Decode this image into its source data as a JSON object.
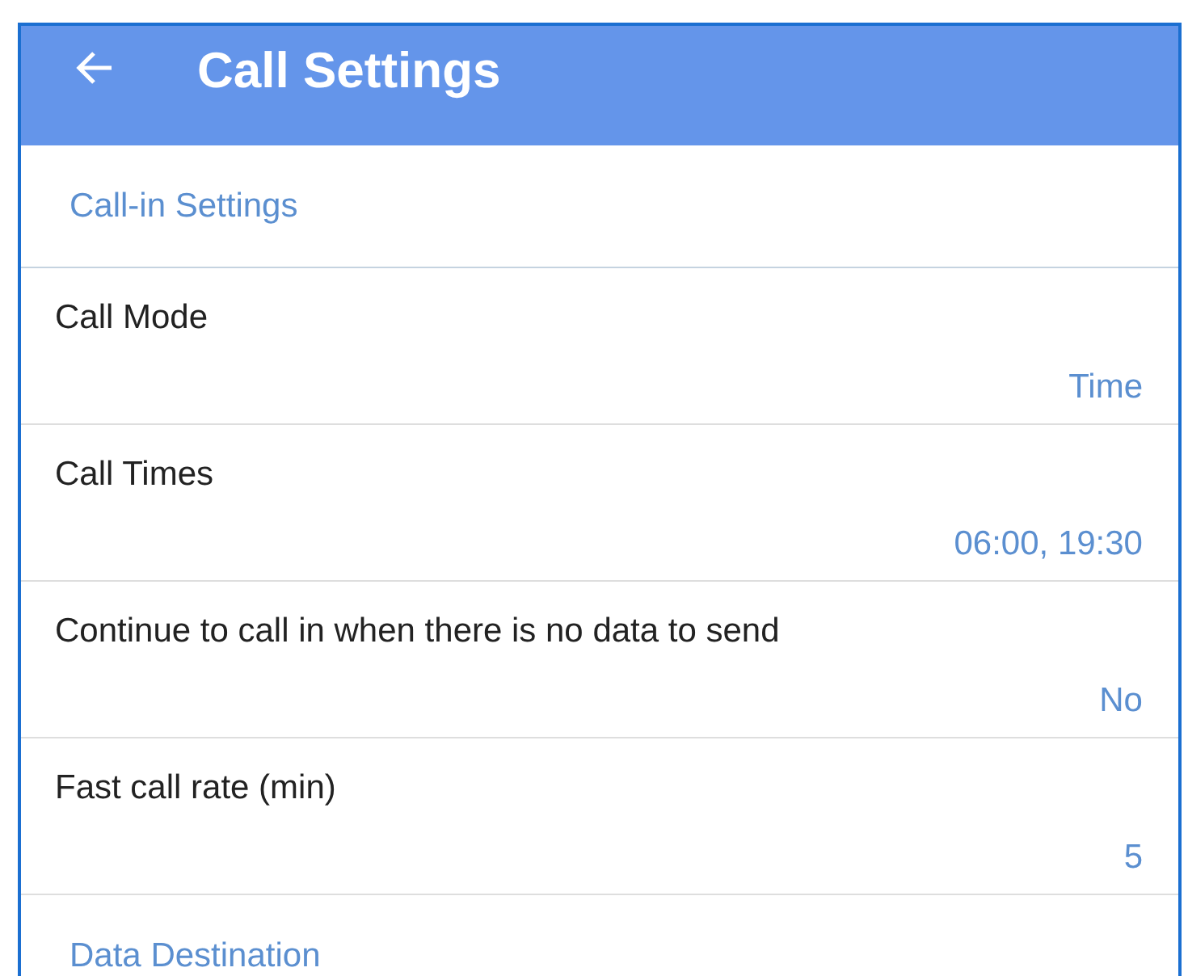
{
  "header": {
    "title": "Call Settings"
  },
  "sections": [
    {
      "title": "Call-in Settings",
      "rows": [
        {
          "label": "Call Mode",
          "value": "Time"
        },
        {
          "label": "Call Times",
          "value": "06:00, 19:30"
        },
        {
          "label": "Continue to call in when there is no data to send",
          "value": "No"
        },
        {
          "label": "Fast call rate (min)",
          "value": "5"
        }
      ]
    },
    {
      "title": "Data Destination"
    }
  ]
}
